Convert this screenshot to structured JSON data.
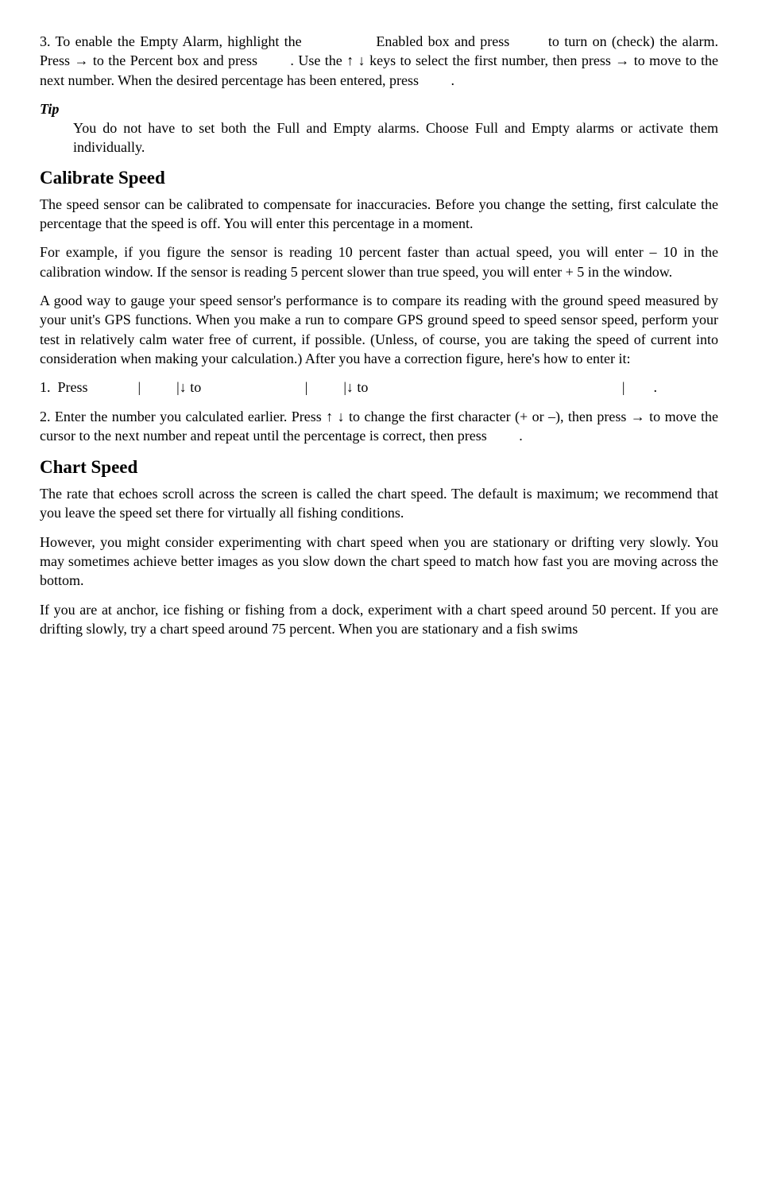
{
  "p1": "3. To enable the Empty Alarm, highlight the           Enabled box and press      to turn on (check) the alarm. Press → to the Percent box and press     . Use the ↑ ↓ keys to select the first number, then press → to move to the next number. When the desired percentage has been entered, press     .",
  "tip_label": "Tip",
  "tip_body": "You do not have to set both the Full and Empty alarms. Choose Full and Empty alarms or activate them individually.",
  "h_calibrate": "Calibrate Speed",
  "cal_p1": "The speed sensor can be calibrated to compensate for inaccuracies. Before you change the setting, first calculate the percentage that the speed is off. You will enter this percentage in a moment.",
  "cal_p2": "For example, if you figure the sensor is reading 10 percent faster than actual speed, you will enter – 10 in the calibration window. If the sensor is reading 5 percent slower than true speed, you will enter + 5 in the window.",
  "cal_p3": "A good way to gauge your speed sensor's performance is to compare its reading with the ground speed measured by your unit's GPS functions. When you make a run to compare GPS ground speed to speed sensor speed, perform your test in relatively calm water free of current, if possible. (Unless, of course, you are taking the speed of current into consideration when making your calculation.) After you have a correction figure, here's how to enter it:",
  "cal_step1": "1. Press       |     |↓ to               |     |↓ to                                    |    .",
  "cal_step2": "2. Enter the number you calculated earlier. Press ↑ ↓ to change the first character (+ or –), then press → to move the cursor to the next number and repeat until the percentage is correct, then press     .",
  "h_chart": "Chart Speed",
  "chart_p1": "The rate that echoes scroll across the screen is called the chart speed. The default is maximum; we recommend that you leave the speed set there for virtually all fishing conditions.",
  "chart_p2": "However, you might consider experimenting with chart speed when you are stationary or drifting very slowly. You may sometimes achieve better images as you slow down the chart speed to match how fast you are moving across the bottom.",
  "chart_p3": "If you are at anchor, ice fishing or fishing from a dock, experiment with a chart speed around 50 percent. If you are drifting slowly, try a chart speed around 75 percent. When you are stationary and a fish swims"
}
